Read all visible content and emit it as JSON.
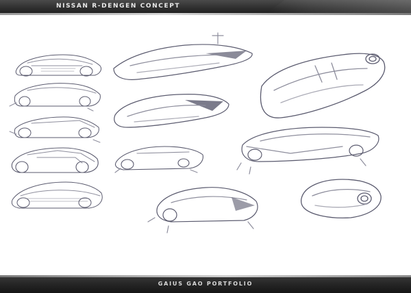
{
  "header": {
    "title": "NISSAN R-DENGEN CONCEPT"
  },
  "footer": {
    "credit": "GAIUS GAO PORTFOLIO"
  },
  "colors": {
    "pencil": "#5a5a6e",
    "shade": "#8d8d9c",
    "bar": "#2a2a2a"
  },
  "sketches": [
    {
      "name": "sketch-side-view-1"
    },
    {
      "name": "sketch-side-view-2"
    },
    {
      "name": "sketch-side-view-3"
    },
    {
      "name": "sketch-side-view-4"
    },
    {
      "name": "sketch-side-view-5"
    },
    {
      "name": "sketch-top-perspective-1"
    },
    {
      "name": "sketch-top-perspective-2"
    },
    {
      "name": "sketch-side-view-6"
    },
    {
      "name": "sketch-rear-perspective"
    },
    {
      "name": "sketch-large-perspective"
    },
    {
      "name": "sketch-three-quarter-view"
    },
    {
      "name": "sketch-top-view"
    }
  ]
}
